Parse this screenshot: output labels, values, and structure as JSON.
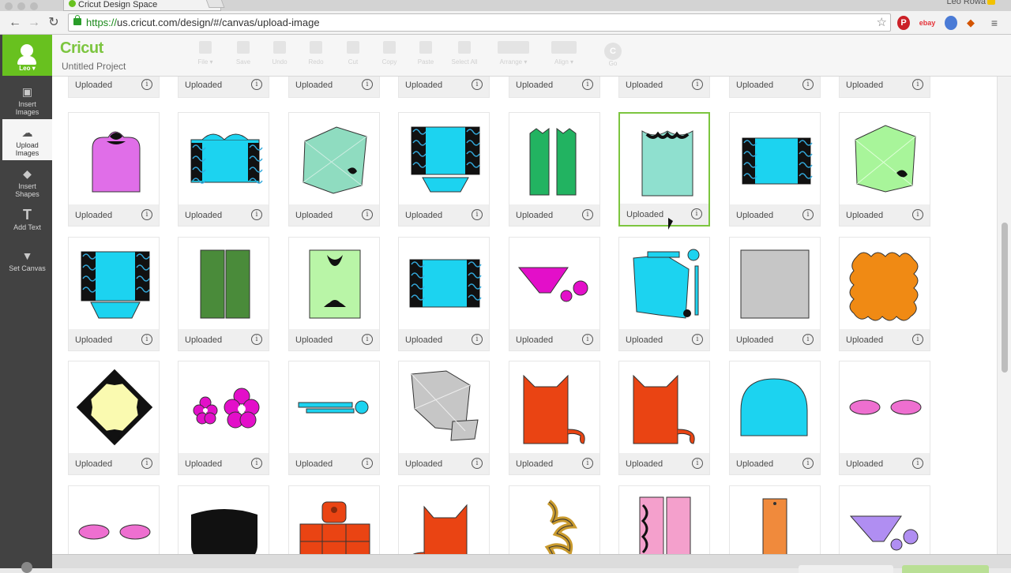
{
  "browser": {
    "tab_title": "Cricut Design Space",
    "url_scheme": "https://",
    "url_rest": "us.cricut.com/design/#/canvas/upload-image",
    "profile_name": "Leo Rowa",
    "back": "←",
    "forward": "→",
    "reload": "↻",
    "bookmark_star": "☆",
    "pinterest": "P",
    "ebay": "ebay",
    "menu": "≡"
  },
  "sidebar": {
    "user": "Leo ▾",
    "items": [
      {
        "label_1": "Insert",
        "label_2": "Images",
        "icon": "image-icon",
        "glyph": "▣"
      },
      {
        "label_1": "Upload",
        "label_2": "Images",
        "icon": "cloud-upload-icon",
        "glyph": "☁"
      },
      {
        "label_1": "Insert",
        "label_2": "Shapes",
        "icon": "shapes-icon",
        "glyph": "◆"
      },
      {
        "label_1": "Add Text",
        "label_2": "",
        "icon": "text-icon",
        "glyph": "T"
      },
      {
        "label_1": "Set Canvas",
        "label_2": "",
        "icon": "shirt-icon",
        "glyph": "👕"
      }
    ]
  },
  "header": {
    "logo": "Cricut",
    "project": "Untitled Project",
    "tools": [
      "File ▾",
      "Save",
      "Undo",
      "Redo",
      "Cut",
      "Copy",
      "Paste",
      "Select All",
      "Arrange ▾",
      "Align ▾"
    ],
    "go": "C",
    "go_label": "Go"
  },
  "gallery": {
    "card_label": "Uploaded",
    "info_glyph": "i",
    "row_top_count": 8,
    "rows": [
      [
        "pink-arch",
        "blue-lace-panel",
        "mint-envelope",
        "blue-lace-basket",
        "green-doors",
        "mint-lace-pocket",
        "blue-lace-panel-2",
        "green-envelope"
      ],
      [
        "blue-lace-basket-2",
        "green-panels",
        "green-flourish-card",
        "blue-lace-panel-3",
        "magenta-basket-flowers",
        "blue-envelope-kit",
        "gray-square",
        "orange-scallop"
      ],
      [
        "yellow-diamond",
        "magenta-flowers",
        "blue-strip-circle",
        "gray-envelope",
        "orange-cat",
        "orange-cat-2",
        "blue-dome",
        "pink-ovals"
      ],
      [
        "pink-ovals-2",
        "black-pot",
        "orange-house",
        "orange-cat-3",
        "gold-flourish",
        "pink-bookmarks",
        "orange-bookmark",
        "purple-basket-flowers"
      ]
    ],
    "selected": [
      0,
      5
    ]
  },
  "colors": {
    "accent_green": "#7cc53f",
    "sidebar_bg": "#424242"
  }
}
